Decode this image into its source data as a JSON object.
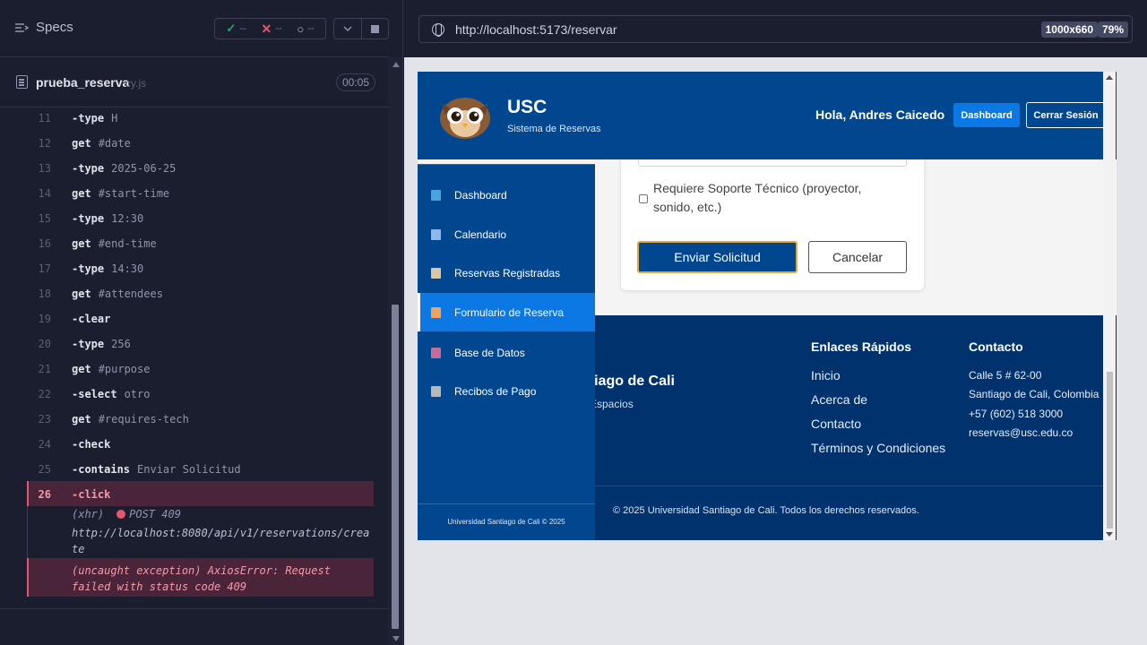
{
  "reporter": {
    "specs_label": "Specs",
    "stats": {
      "passed": "--",
      "failed": "--",
      "pending": "--"
    },
    "file": {
      "name": "prueba_reserva",
      "ext": "cy.js",
      "duration": "00:05"
    },
    "commands": [
      {
        "num": "11",
        "name": "-type",
        "arg": "H"
      },
      {
        "num": "12",
        "name": "get",
        "arg": "#date"
      },
      {
        "num": "13",
        "name": "-type",
        "arg": "2025-06-25"
      },
      {
        "num": "14",
        "name": "get",
        "arg": "#start-time"
      },
      {
        "num": "15",
        "name": "-type",
        "arg": "12:30"
      },
      {
        "num": "16",
        "name": "get",
        "arg": "#end-time"
      },
      {
        "num": "17",
        "name": "-type",
        "arg": "14:30"
      },
      {
        "num": "18",
        "name": "get",
        "arg": "#attendees"
      },
      {
        "num": "19",
        "name": "-clear",
        "arg": ""
      },
      {
        "num": "20",
        "name": "-type",
        "arg": "256"
      },
      {
        "num": "21",
        "name": "get",
        "arg": "#purpose"
      },
      {
        "num": "22",
        "name": "-select",
        "arg": "otro"
      },
      {
        "num": "23",
        "name": "get",
        "arg": "#requires-tech"
      },
      {
        "num": "24",
        "name": "-check",
        "arg": ""
      },
      {
        "num": "25",
        "name": "-contains",
        "arg": "Enviar Solicitud"
      },
      {
        "num": "26",
        "name": "-click",
        "arg": ""
      }
    ],
    "xhr": {
      "label": "(xhr)",
      "method": "POST 409",
      "url": "http://localhost:8080/api/v1/reservations/create"
    },
    "exception": "(uncaught exception)  AxiosError: Request failed with status code 409"
  },
  "aut": {
    "url": "http://localhost:5173/reservar",
    "viewport": "1000x660",
    "zoom": "79%"
  },
  "app": {
    "header": {
      "brand": "USC",
      "subtitle": "Sistema de Reservas",
      "greeting": "Hola, Andres Caicedo",
      "dashboard_btn": "Dashboard",
      "logout_btn": "Cerrar Sesión"
    },
    "form": {
      "tech_label": "Requiere Soporte Técnico (proyector, sonido, etc.)",
      "submit": "Enviar Solicitud",
      "cancel": "Cancelar"
    },
    "sidebar": {
      "items": [
        {
          "label": "Dashboard",
          "icon": "chart-icon",
          "color": "#4aa3df"
        },
        {
          "label": "Calendario",
          "icon": "calendar-icon",
          "color": "#8fb8e8"
        },
        {
          "label": "Reservas Registradas",
          "icon": "clipboard-icon",
          "color": "#d9c7a6"
        },
        {
          "label": "Formulario de Reserva",
          "icon": "memo-icon",
          "color": "#f0a35a"
        },
        {
          "label": "Base de Datos",
          "icon": "floppy-disk-icon",
          "color": "#c46b9a"
        },
        {
          "label": "Recibos de Pago",
          "icon": "receipt-icon",
          "color": "#b8b8b8"
        }
      ],
      "footer": "Universidad Santiago de Cali © 2025"
    },
    "footer": {
      "title_partial": "ntiago de Cali",
      "subtitle_partial": "e Espacios",
      "quick_links_title": "Enlaces Rápidos",
      "quick_links": [
        "Inicio",
        "Acerca de",
        "Contacto",
        "Términos y Condiciones"
      ],
      "contact_title": "Contacto",
      "contact": [
        "Calle 5 # 62-00",
        "Santiago de Cali, Colombia",
        "+57 (602) 518 3000",
        "reservas@usc.edu.co"
      ],
      "copyright": "© 2025 Universidad Santiago de Cali. Todos los derechos reservados."
    }
  }
}
